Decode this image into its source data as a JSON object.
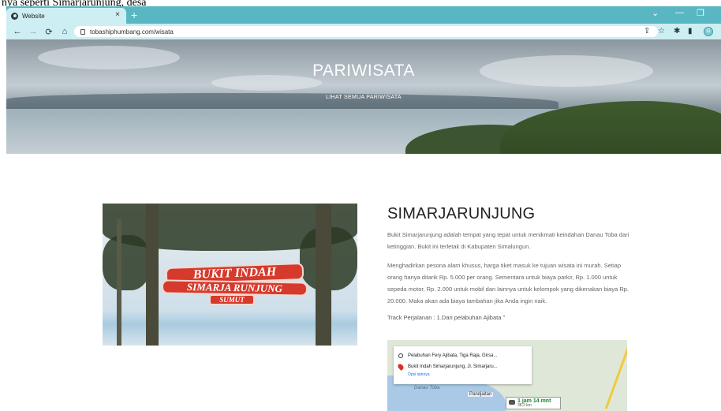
{
  "document_text": "nya seperti Simarjarunjung, desa",
  "browser": {
    "tab_title": "Website",
    "tab_close": "×",
    "new_tab": "+",
    "url": "tobashiphumbang.com/wisata",
    "profile_initial": "G",
    "controls": {
      "chevron": "⌄",
      "minimize": "—",
      "restore": "❐"
    }
  },
  "hero": {
    "title": "PARIWISATA",
    "link": "LIHAT SEMUA PARIWISATA"
  },
  "photo": {
    "sign_line1": "BUKIT INDAH",
    "sign_line2": "SIMARJA RUNJUNG",
    "sign_line3": "SUMUT"
  },
  "article": {
    "title": "SIMARJARUNJUNG",
    "paragraph1": "Bukit Simarjarunjung adalah tempat yang tepat untuk menikmati keindahan Danau Toba dari ketinggian. Bukit ini terletak di Kabupaten Simalungun.",
    "paragraph2": "Menghadirkan pesona alam khusus, harga tiket masuk ke tujuan wisata ini murah. Setiap orang hanya ditarik Rp. 5.000 per orang. Sementara untuk biaya parkir, Rp. 1.000 untuk sepeda motor, Rp. 2.000 untuk mobil dan lainnya untuk kelompok yang dikenakan biaya Rp. 20.000. Maka akan ada biaya tambahan jika Anda ingin naik.",
    "track": "Track Perjalanan : 1.Dari pelabuhan Ajibata \""
  },
  "map": {
    "origin": "Pelabuhan Fery Ajibata, Tiga Raja, Girsa...",
    "destination": "Bukit Indah Simarjarunjung, Jl. Simarjaru...",
    "options": "Opsi lainnya",
    "lake_label": "Danau Toba",
    "place_label": "Pandjaitan",
    "duration": "1 jam 14 mnt",
    "distance": "38,3 km"
  }
}
